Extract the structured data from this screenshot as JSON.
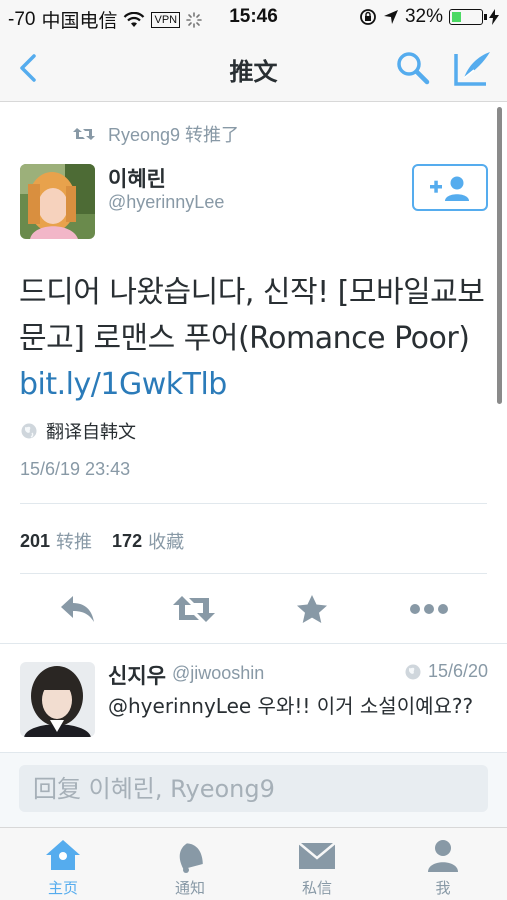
{
  "status_bar": {
    "signal": "-70",
    "carrier": "中国电信",
    "vpn": "VPN",
    "time": "15:46",
    "battery": "32%",
    "battery_level": 0.32
  },
  "nav": {
    "title": "推文",
    "icons": {
      "back": "chevron-left-icon",
      "search": "search-icon",
      "compose": "compose-icon"
    }
  },
  "tweet": {
    "retweet_context": "Ryeong9 转推了",
    "author_name": "이혜린",
    "author_handle": "@hyerinnyLee",
    "text_line1": "드디어 나왔습니다, 신작! [모바일교보",
    "text_line2": "문고] 로맨스 푸어(Romance Poor)",
    "link": "bit.ly/1GwkTlb",
    "translate": "翻译自韩文",
    "timestamp": "15/6/19 23:43",
    "retweet_count": "201",
    "retweet_label": "转推",
    "favorite_count": "172",
    "favorite_label": "收藏"
  },
  "reply": {
    "author_name": "신지우",
    "author_handle": "@jiwooshin",
    "date": "15/6/20",
    "text": "@hyerinnyLee 우와!! 이거 소설이예요??"
  },
  "compose": {
    "placeholder": "回复 이혜린, Ryeong9"
  },
  "tabs": [
    {
      "label": "主页",
      "icon": "home-icon",
      "active": true
    },
    {
      "label": "通知",
      "icon": "bell-icon",
      "active": false
    },
    {
      "label": "私信",
      "icon": "envelope-icon",
      "active": false
    },
    {
      "label": "我",
      "icon": "person-icon",
      "active": false
    }
  ],
  "colors": {
    "accent": "#55acee",
    "link": "#2b7bb9",
    "muted": "#8899a6",
    "text": "#292f33",
    "battery_fill": "#4cd964"
  }
}
